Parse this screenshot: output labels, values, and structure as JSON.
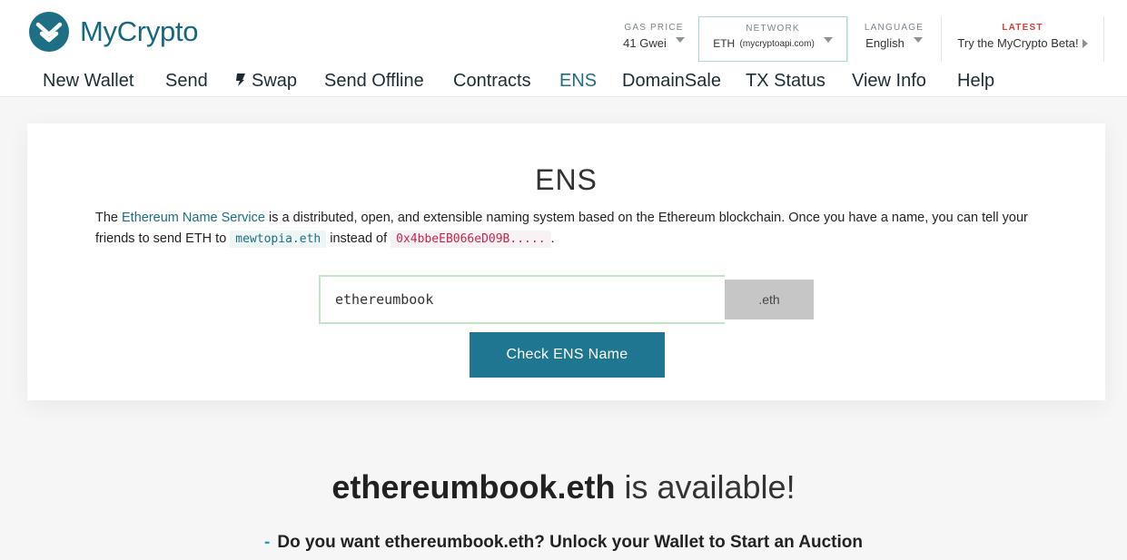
{
  "brand": {
    "name": "MyCrypto"
  },
  "header": {
    "gas": {
      "caption": "GAS PRICE",
      "value": "41 Gwei"
    },
    "network": {
      "caption": "NETWORK",
      "value": "ETH",
      "detail": "(mycryptoapi.com)"
    },
    "language": {
      "caption": "LANGUAGE",
      "value": "English"
    },
    "latest": {
      "caption": "LATEST",
      "value": "Try the MyCrypto Beta!"
    }
  },
  "nav": {
    "items": [
      {
        "label": "New Wallet"
      },
      {
        "label": "Send"
      },
      {
        "label": "Swap"
      },
      {
        "label": "Send Offline"
      },
      {
        "label": "Contracts"
      },
      {
        "label": "ENS"
      },
      {
        "label": "DomainSale"
      },
      {
        "label": "TX Status"
      },
      {
        "label": "View Info"
      },
      {
        "label": "Help"
      }
    ],
    "active": "ENS"
  },
  "ens": {
    "title": "ENS",
    "desc_prefix": "The ",
    "desc_link": "Ethereum Name Service",
    "desc_middle": " is a distributed, open, and extensible naming system based on the Ethereum blockchain. Once you have a name, you can tell your friends to send ETH to ",
    "example_name": "mewtopia.eth",
    "desc_instead": " instead of ",
    "example_address": "0x4bbeEB066eD09B.....",
    "desc_end": ".",
    "input_value": "ethereumbook",
    "suffix": ".eth",
    "check_label": "Check ENS Name"
  },
  "result": {
    "name": "ethereumbook.eth",
    "status": "is available!",
    "dash": "-",
    "action": "Do you want ethereumbook.eth? Unlock your Wallet to Start an Auction"
  },
  "colors": {
    "brand": "#1e6e85",
    "button": "#1e7690",
    "latest": "#d9403a",
    "input_border": "#bfe6c6"
  }
}
